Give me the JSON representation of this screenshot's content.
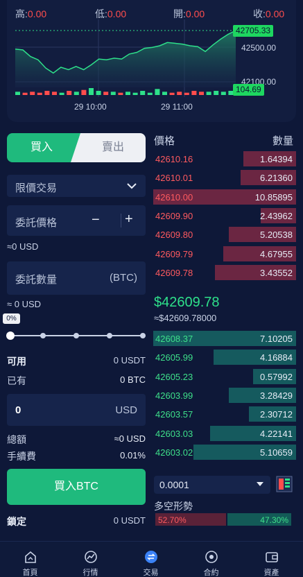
{
  "ohlc": {
    "high_label": "高:",
    "high_value": "0.00",
    "low_label": "低:",
    "low_value": "0.00",
    "open_label": "開:",
    "open_value": "0.00",
    "close_label": "收:",
    "close_value": "0.00"
  },
  "chart_data": {
    "type": "area",
    "x": [
      "29 10:00",
      "29 11:00"
    ],
    "price_axis_ticks": [
      "42705.33",
      "42500.00",
      "42100.00"
    ],
    "current_price": "42705.33",
    "volume_value": "104.69",
    "series": [
      {
        "values": [
          42480,
          42470,
          42390,
          42350,
          42250,
          42190,
          42260,
          42230,
          42270,
          42230,
          42290,
          42360,
          42350,
          42370,
          42360,
          42420,
          42440,
          42490,
          42500,
          42520,
          42560,
          42550,
          42540,
          42520,
          42510,
          42450,
          42530,
          42600,
          42660,
          42705
        ]
      }
    ],
    "volume_values": [
      2,
      1,
      2,
      1,
      3,
      2,
      1,
      3,
      2,
      4,
      6,
      3,
      2,
      2,
      1,
      2,
      1,
      3,
      1,
      5,
      2,
      1,
      2,
      1,
      3,
      2,
      2,
      3,
      2,
      3
    ],
    "colors": {
      "line": "#2ee08a",
      "area_top": "#1f7f62",
      "area_bottom": "#17274a",
      "up": "#2ee08a",
      "down": "#ff4d4d"
    }
  },
  "trade": {
    "buy_tab": "買入",
    "sell_tab": "賣出",
    "order_type": "限價交易",
    "price_placeholder": "委託價格",
    "price_minus": "−",
    "price_plus": "+",
    "price_fiat": "≈0 USD",
    "amount_placeholder": "委託數量",
    "amount_unit": "(BTC)",
    "amount_fiat": "≈ 0 USD",
    "slider_value": "0%",
    "available_label": "可用",
    "available_value": "0 USDT",
    "holding_label": "已有",
    "holding_value": "0 BTC",
    "total_input_value": "0",
    "total_input_unit": "USD",
    "sum_label": "總額",
    "sum_value": "≈0 USD",
    "fee_label": "手續費",
    "fee_value": "0.01%",
    "buy_button": "買入BTC",
    "locked_label": "鎖定",
    "locked_value": "0 USDT"
  },
  "orderbook": {
    "price_header": "價格",
    "qty_header": "數量",
    "asks": [
      {
        "price": "42610.16",
        "qty": "1.64394",
        "depth": 0.37
      },
      {
        "price": "42610.01",
        "qty": "6.21360",
        "depth": 0.39
      },
      {
        "price": "42610.00",
        "qty": "10.85895",
        "depth": 1.0
      },
      {
        "price": "42609.90",
        "qty": "2.43962",
        "depth": 0.25
      },
      {
        "price": "42609.80",
        "qty": "5.20538",
        "depth": 0.47
      },
      {
        "price": "42609.79",
        "qty": "4.67955",
        "depth": 0.51
      },
      {
        "price": "42609.78",
        "qty": "3.43552",
        "depth": 0.57
      }
    ],
    "last_price": "$42609.78",
    "last_price_fiat": "≈$42609.78000",
    "bids": [
      {
        "price": "42608.37",
        "qty": "7.10205",
        "depth": 1.0
      },
      {
        "price": "42605.99",
        "qty": "4.16884",
        "depth": 0.58
      },
      {
        "price": "42605.23",
        "qty": "0.57992",
        "depth": 0.3
      },
      {
        "price": "42603.99",
        "qty": "3.28429",
        "depth": 0.47
      },
      {
        "price": "42603.57",
        "qty": "2.30712",
        "depth": 0.33
      },
      {
        "price": "42603.03",
        "qty": "4.22141",
        "depth": 0.6
      },
      {
        "price": "42603.02",
        "qty": "5.10659",
        "depth": 0.72
      }
    ],
    "depth_select": "0.0001",
    "trend_label": "多空形勢",
    "bear_pct": "52.70%",
    "bull_pct": "47.30%",
    "bear_fraction": 0.527
  },
  "nav": [
    {
      "label": "首頁",
      "icon": "home-icon"
    },
    {
      "label": "行情",
      "icon": "market-icon"
    },
    {
      "label": "交易",
      "icon": "trade-icon"
    },
    {
      "label": "合約",
      "icon": "contract-icon"
    },
    {
      "label": "資產",
      "icon": "wallet-icon"
    }
  ]
}
